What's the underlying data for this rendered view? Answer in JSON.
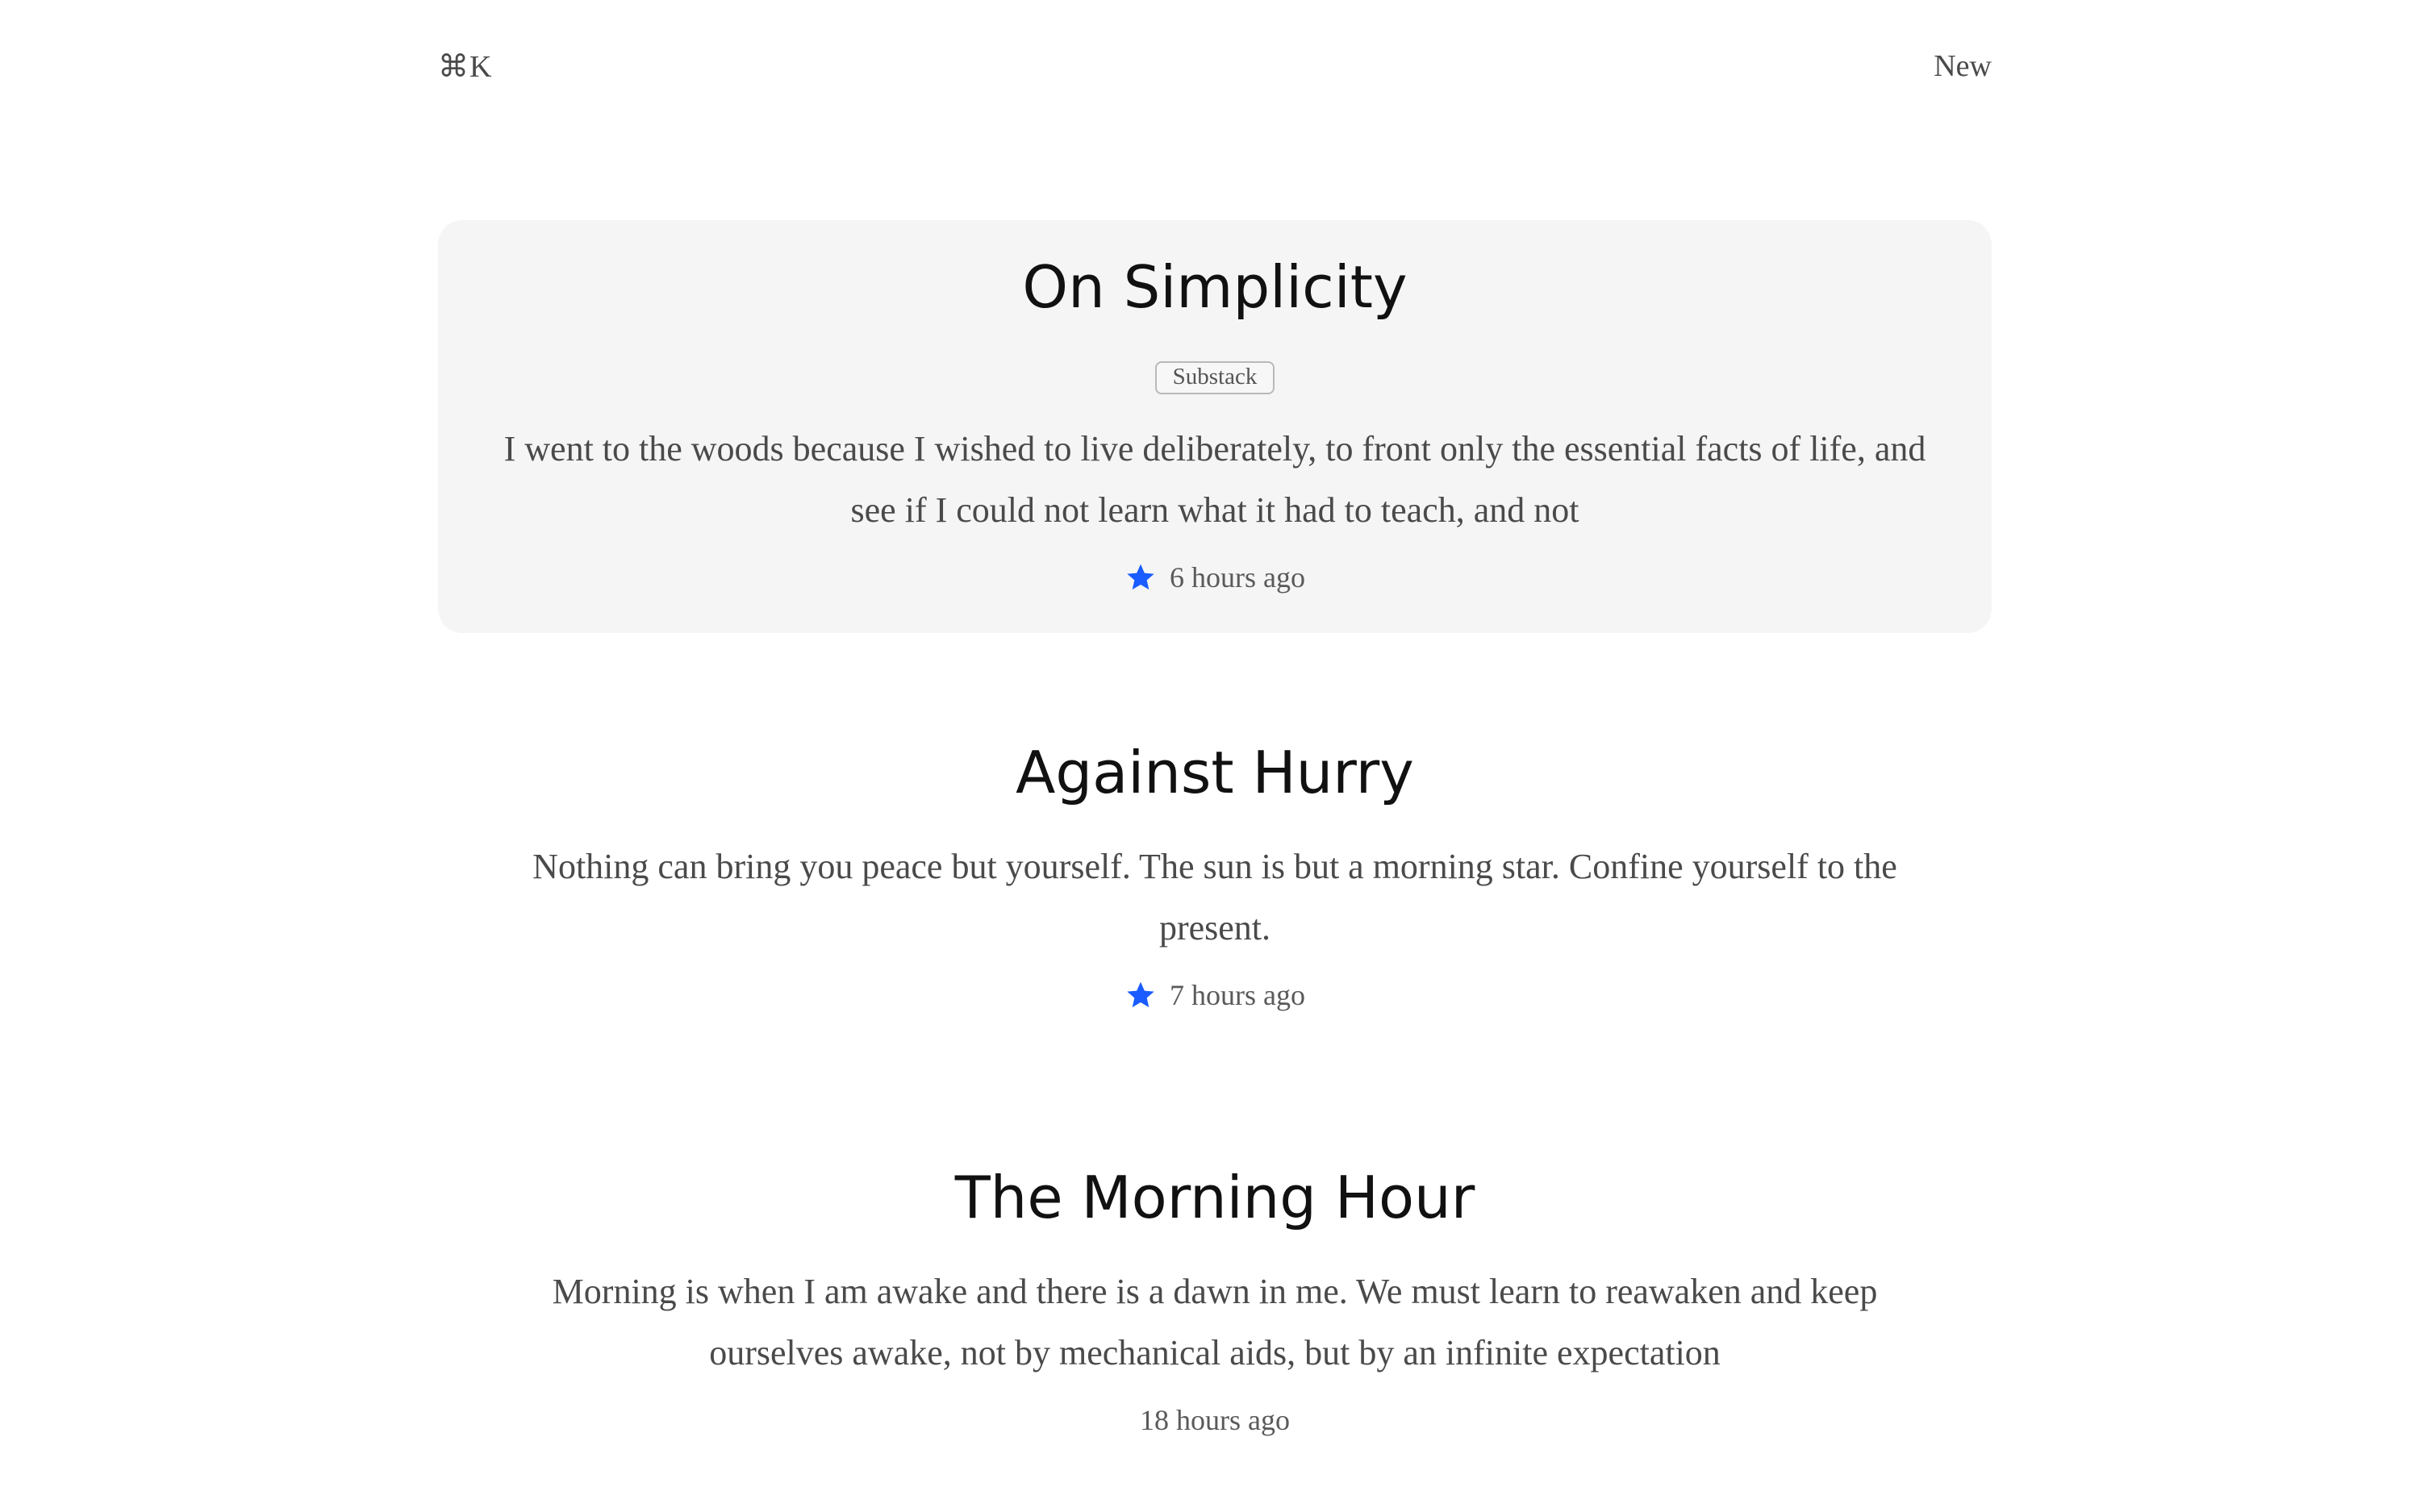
{
  "header": {
    "shortcut_label": "⌘K",
    "new_label": "New"
  },
  "accent_color": "#1a5cff",
  "posts": [
    {
      "title": "On Simplicity",
      "tag": "Substack",
      "excerpt": "I went to the woods because I wished to live deliberately, to front only the essential facts of life, and see if I could not learn what it had to teach, and not",
      "time": "6 hours ago",
      "starred": true,
      "selected": true
    },
    {
      "title": "Against Hurry",
      "excerpt": "Nothing can bring you peace but yourself. The sun is but a morning star. Confine yourself to the present.",
      "time": "7 hours ago",
      "starred": true,
      "selected": false
    },
    {
      "title": "The Morning Hour",
      "excerpt": "Morning is when I am awake and there is a dawn in me. We must learn to reawaken and keep ourselves awake, not by mechanical aids, but by an infinite expectation",
      "time": "18 hours ago",
      "starred": false,
      "selected": false
    }
  ]
}
